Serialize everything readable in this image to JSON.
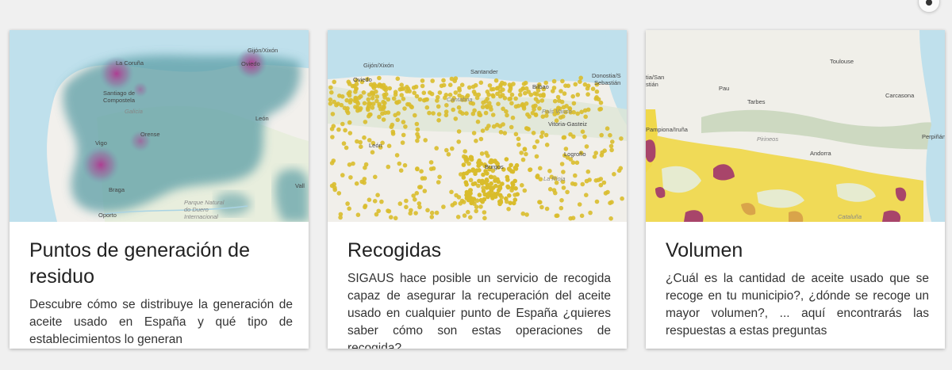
{
  "cards": [
    {
      "title": "Puntos de generación de residuo",
      "description": "Descubre cómo se distribuye la generación de aceite usado en España y qué tipo de establecimientos lo generan",
      "map_labels": [
        "Gijón/Xixón",
        "La Coruña",
        "Oviedo",
        "Santiago de Compostela",
        "Galicia",
        "León",
        "Vigo",
        "Orense",
        "Braga",
        "Oporto",
        "Parque Natural do Douro Internacional",
        "Vall"
      ]
    },
    {
      "title": "Recogidas",
      "description": "SIGAUS hace posible un servicio de recogida capaz de asegurar la recuperación del aceite usado en cualquier punto de España ¿quieres saber cómo son estas operaciones de recogida?",
      "map_labels": [
        "Gijón/Xixón",
        "Oviedo",
        "Santander",
        "Donostia/S",
        "Sebastián",
        "Bilbao",
        "Cantabria",
        "País Vasco",
        "Vitoria-Gasteiz",
        "León",
        "Burgos",
        "Logroño",
        "La Rioja"
      ]
    },
    {
      "title": "Volumen",
      "description": "¿Cuál es la cantidad de aceite usado que se recoge en tu municipio?, ¿dónde se recoge un mayor volumen?, ... aquí encontrarás las respuestas a estas preguntas",
      "map_labels": [
        "tia/San",
        "stián",
        "Toulouse",
        "Pau",
        "Tarbes",
        "Carcasona",
        "Pampiona/Iruña",
        "Pirineos",
        "Perpiñán",
        "Andorra",
        "Cataluña"
      ]
    }
  ],
  "colors": {
    "heatmap": "#5b9ea6",
    "dots": "#d9bc2c",
    "volume_low": "#f0d84a",
    "volume_high": "#a8456a"
  }
}
